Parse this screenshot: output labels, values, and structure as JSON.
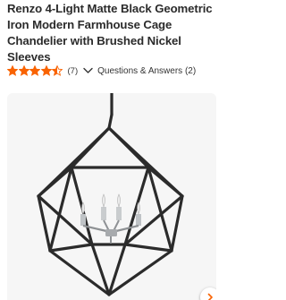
{
  "product": {
    "title": "Renzo 4-Light Matte Black Geometric Iron Modern Farmhouse Cage Chandelier with Brushed Nickel Sleeves"
  },
  "rating": {
    "stars": 4.5,
    "max_stars": 5,
    "review_count": "(7)",
    "star_color": "#f96302",
    "chevron_icon": "chevron-down-icon"
  },
  "qa": {
    "label": "Questions & Answers (2)"
  },
  "gallery": {
    "image_subject": "geometric cage chandelier",
    "accent_color": "#f96302",
    "next_icon": "chevron-right-icon"
  }
}
